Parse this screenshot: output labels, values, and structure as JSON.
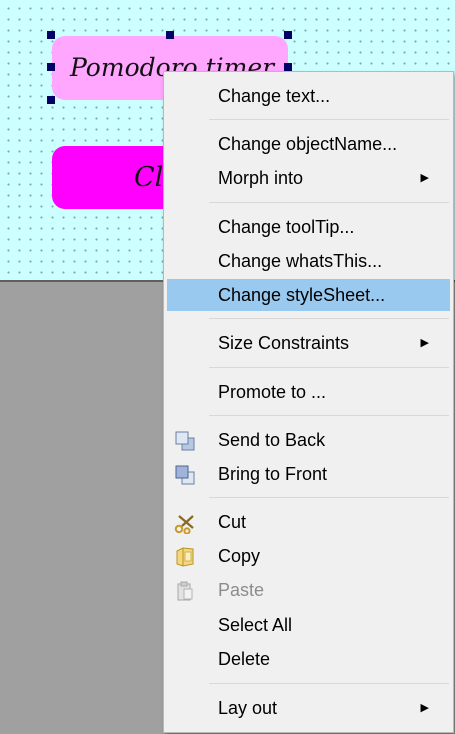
{
  "form": {
    "title_label": "Pomodoro timer",
    "close_button": "Close"
  },
  "context_menu": {
    "items": [
      {
        "label": "Change text..."
      },
      {
        "label": "Change objectName..."
      },
      {
        "label": "Morph into",
        "submenu": true
      },
      {
        "label": "Change toolTip..."
      },
      {
        "label": "Change whatsThis..."
      },
      {
        "label": "Change styleSheet...",
        "highlighted": true
      },
      {
        "label": "Size Constraints",
        "submenu": true
      },
      {
        "label": "Promote to ..."
      },
      {
        "label": "Send to Back",
        "icon": "send-to-back-icon"
      },
      {
        "label": "Bring to Front",
        "icon": "bring-to-front-icon"
      },
      {
        "label": "Cut",
        "icon": "scissors-icon"
      },
      {
        "label": "Copy",
        "icon": "copy-icon"
      },
      {
        "label": "Paste",
        "icon": "paste-icon",
        "disabled": true
      },
      {
        "label": "Select All"
      },
      {
        "label": "Delete"
      },
      {
        "label": "Lay out",
        "submenu": true
      }
    ]
  },
  "colors": {
    "canvas": "#ccffff",
    "label_bg": "#ffa6ff",
    "button_bg": "#ff00ff",
    "menu_highlight": "#99c9ef"
  }
}
